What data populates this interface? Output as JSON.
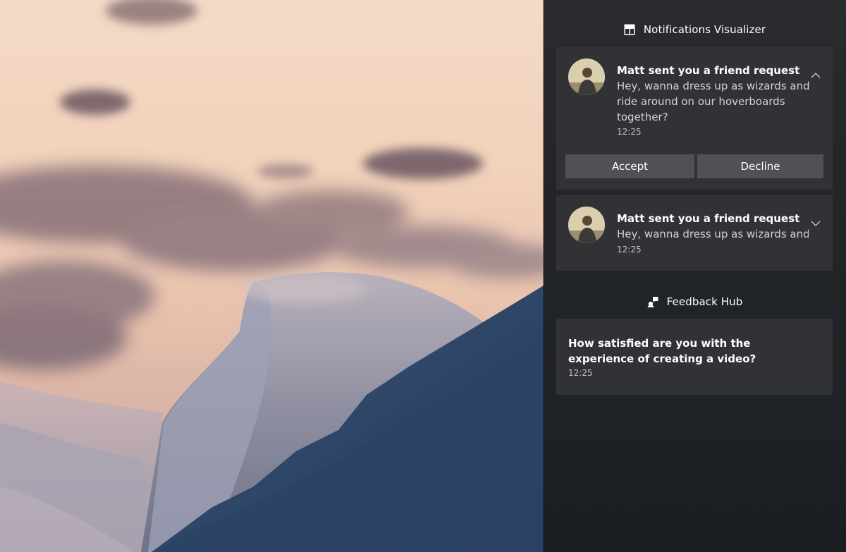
{
  "groups": [
    {
      "app_name": "Notifications Visualizer",
      "icon": "notifications-visualizer-icon"
    },
    {
      "app_name": "Feedback Hub",
      "icon": "feedback-hub-icon"
    }
  ],
  "notifications": [
    {
      "title": "Matt sent you a friend request",
      "body": "Hey, wanna dress up as wizards and ride around on our hoverboards together?",
      "time": "12:25",
      "expanded": true,
      "actions": {
        "accept": "Accept",
        "decline": "Decline"
      }
    },
    {
      "title": "Matt sent you a friend request",
      "body": "Hey, wanna dress up as wizards and r",
      "time": "12:25",
      "expanded": false
    },
    {
      "title": "How satisfied are you with the experience of creating a video?",
      "time": "12:25"
    }
  ],
  "colors": {
    "panel_bg": "#232528",
    "toast_bg": "#323336",
    "button_bg": "#505155",
    "text_primary": "#ffffff",
    "text_secondary": "#d3d3d3"
  }
}
